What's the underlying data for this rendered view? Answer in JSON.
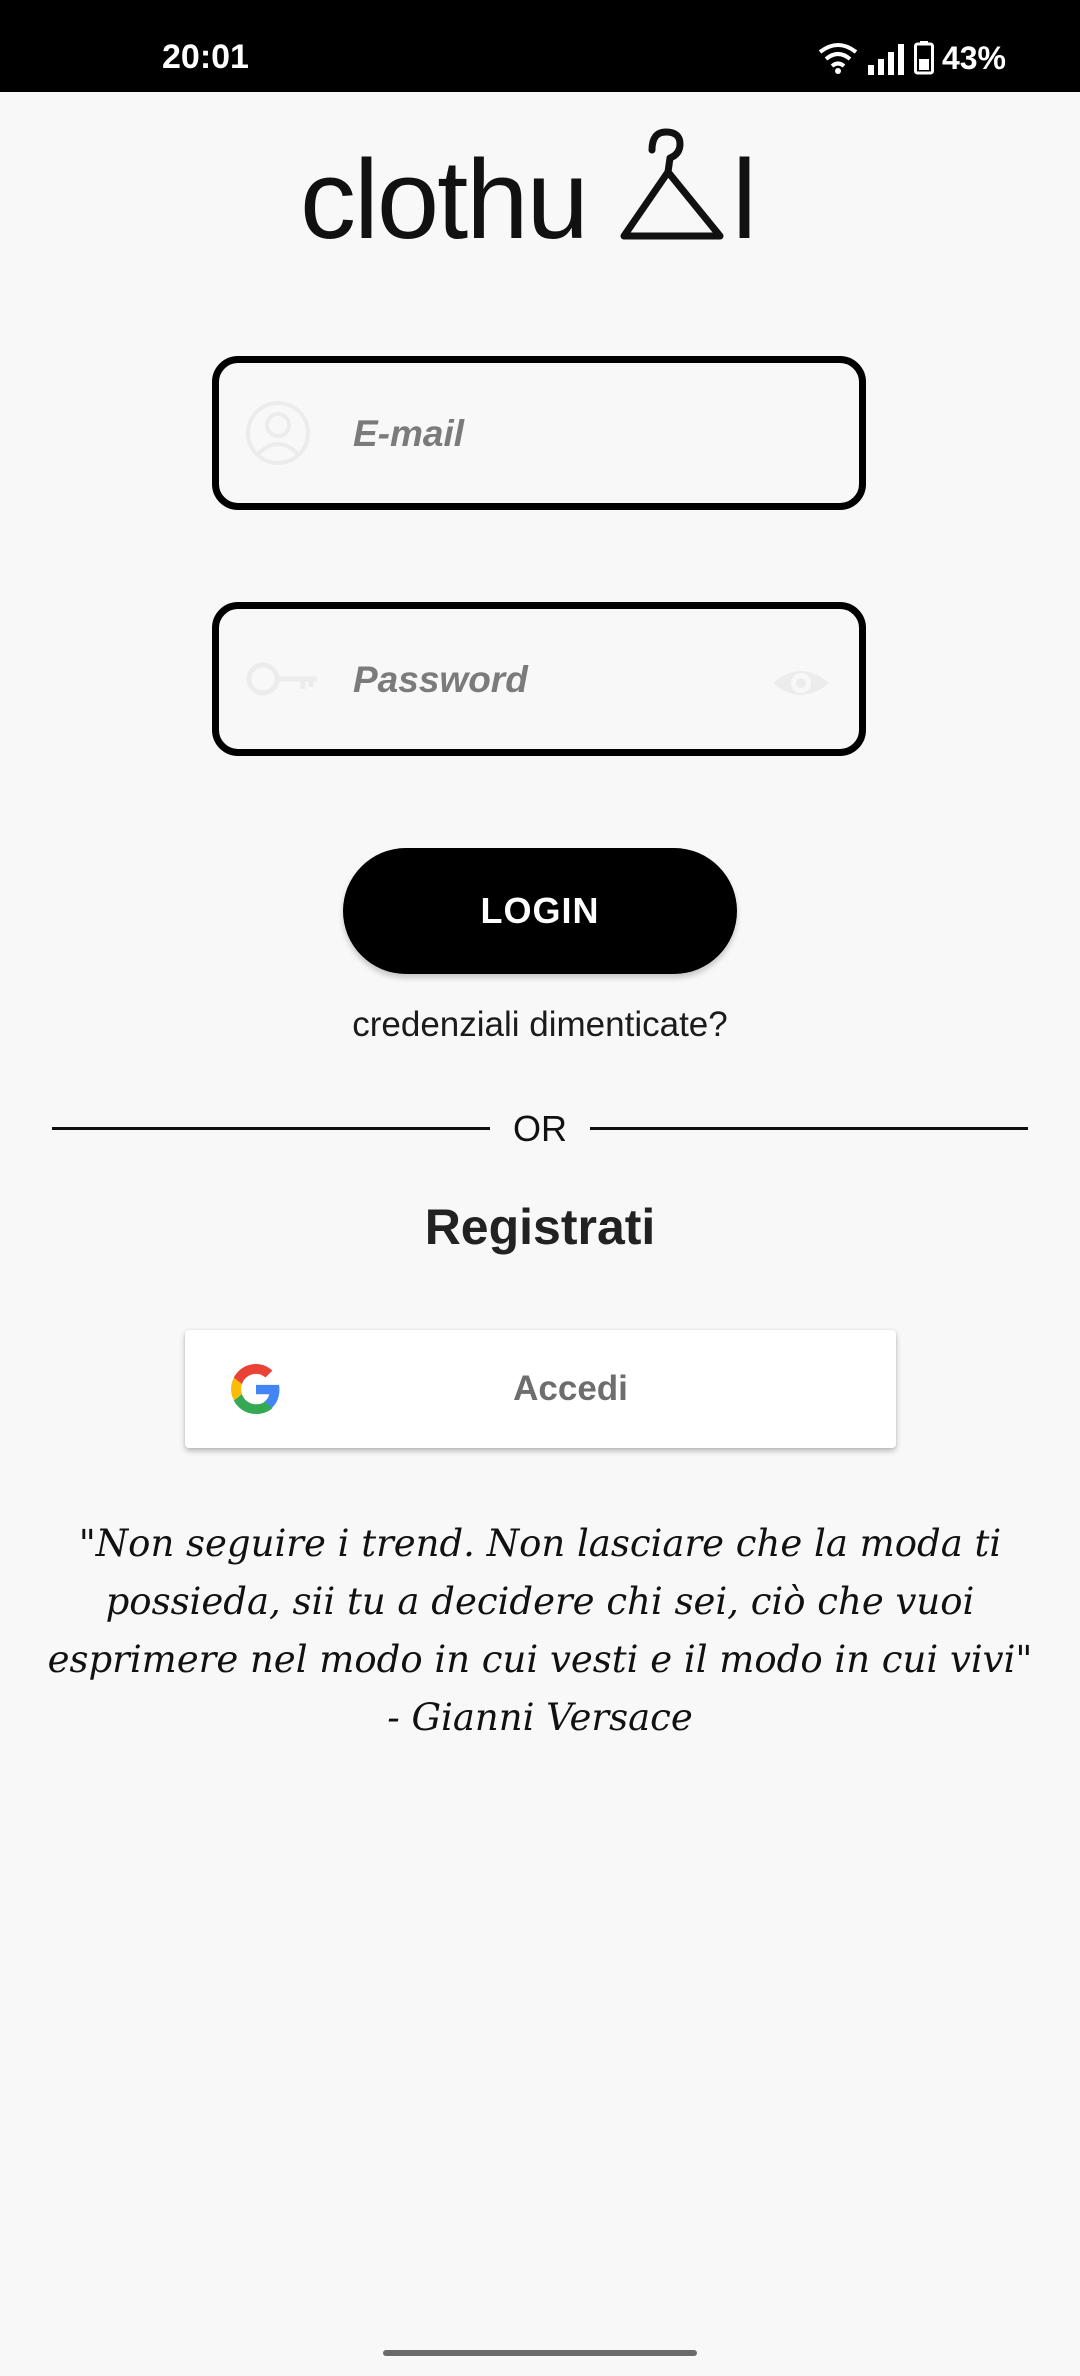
{
  "status_bar": {
    "time": "20:01",
    "battery": "43%",
    "icons": [
      "wifi-icon",
      "signal-icon",
      "battery-icon"
    ]
  },
  "logo": {
    "text": "clothu",
    "icon": "hanger-icon",
    "end_letter": "l"
  },
  "email": {
    "placeholder": "E-mail",
    "value": "",
    "icon": "user-circle-icon"
  },
  "password": {
    "placeholder": "Password",
    "value": "",
    "icon": "key-icon",
    "toggle_icon": "eye-icon"
  },
  "login_button": {
    "label": "LOGIN"
  },
  "forgot_link": {
    "label": "credenziali dimenticate?"
  },
  "divider": {
    "label": "OR"
  },
  "register_link": {
    "label": "Registrati"
  },
  "google_button": {
    "label": "Accedi",
    "icon": "google-icon"
  },
  "quote": {
    "text": "\"Non seguire i trend. Non lasciare che la moda ti possieda, sii tu a decidere chi sei, ciò che vuoi esprimere nel modo in cui vesti e il modo in cui vivi\" - Gianni Versace"
  },
  "colors": {
    "background": "#f8f8f8",
    "primary": "#000000",
    "placeholder": "#7b7b7b",
    "google_label": "#6e6e6e"
  }
}
